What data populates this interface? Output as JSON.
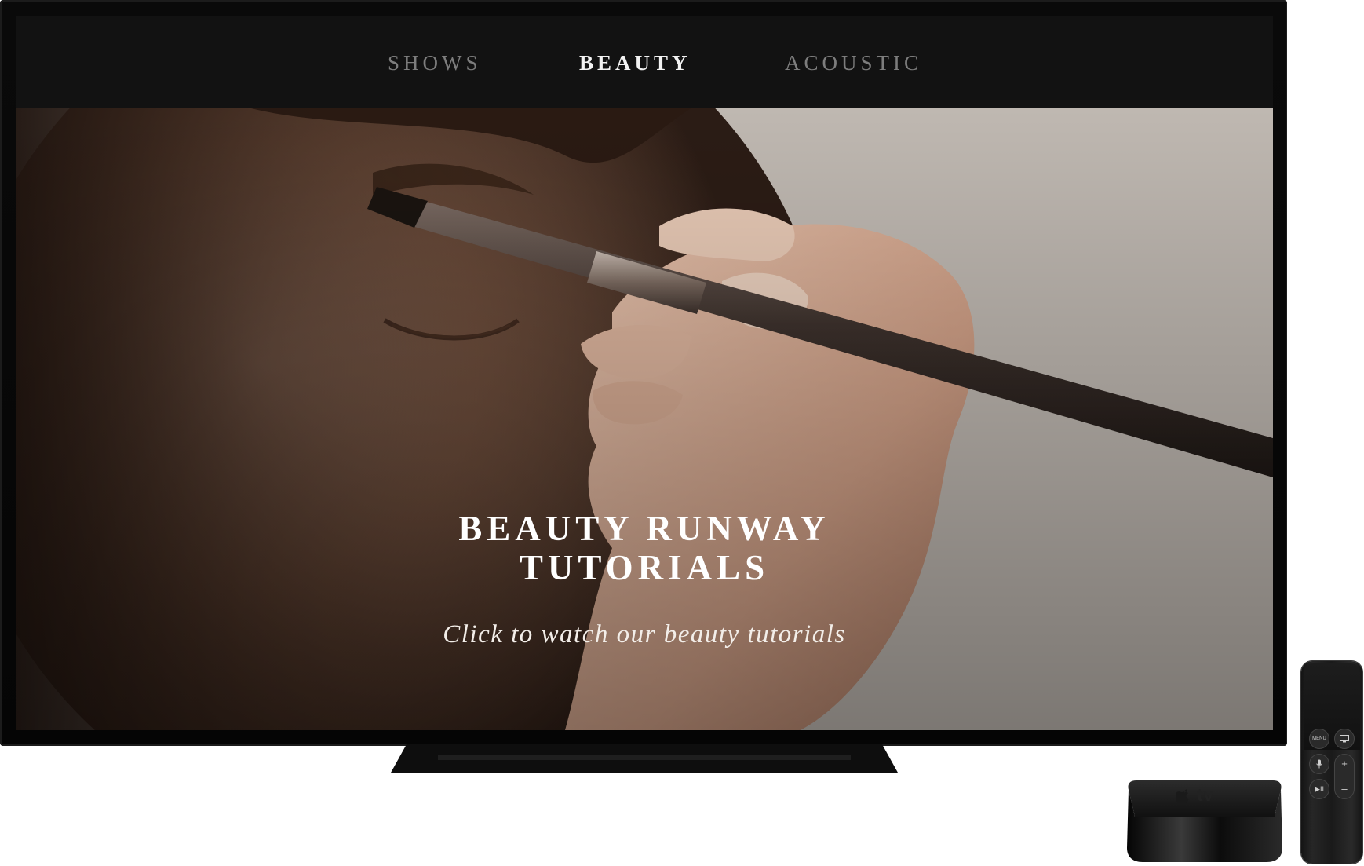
{
  "nav": {
    "items": [
      {
        "label": "SHOWS",
        "active": false
      },
      {
        "label": "BEAUTY",
        "active": true
      },
      {
        "label": "ACOUSTIC",
        "active": false
      }
    ]
  },
  "hero": {
    "title_line1": "BEAUTY RUNWAY",
    "title_line2": "TUTORIALS",
    "subtitle": "Click to watch our beauty tutorials"
  },
  "device": {
    "logo_text": "tv",
    "remote": {
      "menu_label": "MENU",
      "tv_icon": "tv-icon",
      "mic_icon": "microphone-icon",
      "play_pause_label": "▶II",
      "volume_up_label": "+",
      "volume_down_label": "–"
    }
  },
  "colors": {
    "nav_bg": "#121212",
    "nav_active": "#f2f2f2",
    "nav_inactive": "#7d7d7d",
    "hero_text": "#ffffff"
  }
}
